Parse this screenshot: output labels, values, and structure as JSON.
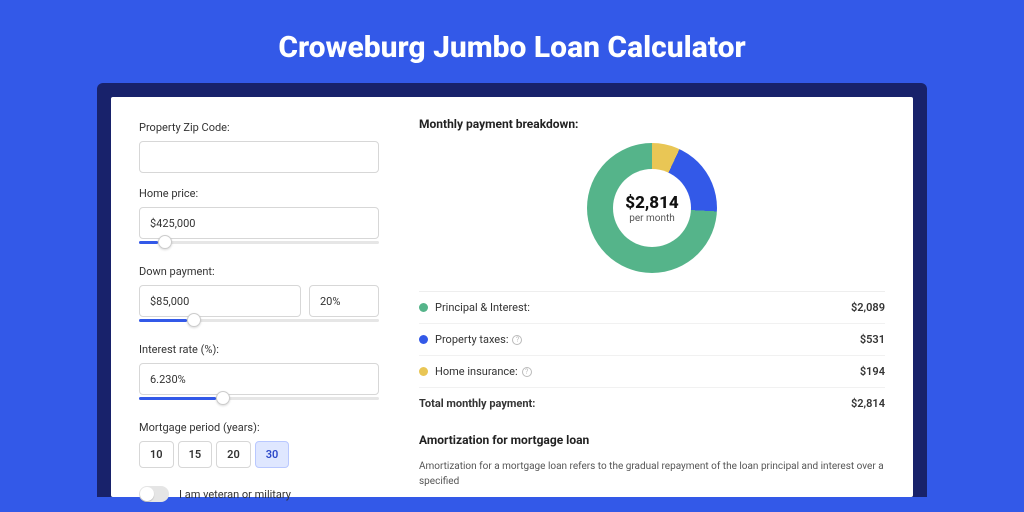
{
  "title": "Croweburg Jumbo Loan Calculator",
  "colors": {
    "accent": "#3359e8",
    "green": "#55b48a",
    "yellow": "#e9c655"
  },
  "form": {
    "zip": {
      "label": "Property Zip Code:",
      "value": ""
    },
    "home_price": {
      "label": "Home price:",
      "value": "$425,000",
      "slider_pct": 8
    },
    "down": {
      "label": "Down payment:",
      "value": "$85,000",
      "pct": "20%",
      "slider_pct": 20
    },
    "rate": {
      "label": "Interest rate (%):",
      "value": "6.230%",
      "slider_pct": 32
    },
    "period": {
      "label": "Mortgage period (years):",
      "options": [
        "10",
        "15",
        "20",
        "30"
      ],
      "selected": "30"
    },
    "military": {
      "label": "I am veteran or military",
      "on": false
    }
  },
  "breakdown": {
    "title": "Monthly payment breakdown:",
    "center_value": "$2,814",
    "center_sub": "per month",
    "items": [
      {
        "label": "Principal & Interest:",
        "value": "$2,089",
        "swatch": "sw-green",
        "info": false
      },
      {
        "label": "Property taxes:",
        "value": "$531",
        "swatch": "sw-blue",
        "info": true
      },
      {
        "label": "Home insurance:",
        "value": "$194",
        "swatch": "sw-yellow",
        "info": true
      }
    ],
    "total": {
      "label": "Total monthly payment:",
      "value": "$2,814"
    }
  },
  "amortization": {
    "title": "Amortization for mortgage loan",
    "text": "Amortization for a mortgage loan refers to the gradual repayment of the loan principal and interest over a specified"
  },
  "chart_data": {
    "type": "pie",
    "title": "Monthly payment breakdown",
    "series": [
      {
        "name": "Monthly payment",
        "values": [
          2089,
          531,
          194
        ]
      }
    ],
    "categories": [
      "Principal & Interest",
      "Property taxes",
      "Home insurance"
    ],
    "total": 2814,
    "unit": "USD/month"
  }
}
